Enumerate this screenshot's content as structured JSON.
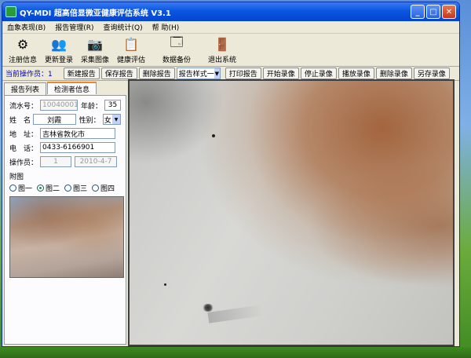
{
  "window": {
    "title": "QY-MDI 超高倍显微亚健康评估系统 V3.1",
    "min_glyph": "_",
    "max_glyph": "□",
    "close_glyph": "✕"
  },
  "menu": [
    "血象表现(B)",
    "报告管理(R)",
    "查询统计(Q)",
    "帮 助(H)"
  ],
  "toolbar": [
    {
      "label": "注册信息",
      "icon": "gear-icon",
      "glyph": "⚙"
    },
    {
      "label": "更新登录",
      "icon": "users-icon",
      "glyph": "👥"
    },
    {
      "label": "采集图像",
      "icon": "camera-icon",
      "glyph": "📷"
    },
    {
      "label": "健康评估",
      "icon": "clipboard-icon",
      "glyph": "📋"
    },
    {
      "label": "数据备份",
      "icon": "backup-icon",
      "glyph": "🗔"
    },
    {
      "label": "退出系统",
      "icon": "exit-icon",
      "glyph": "🚪"
    }
  ],
  "opbar": {
    "operator_label": "当前操作员：1",
    "new_report": "新建报告",
    "save_report": "保存报告",
    "delete_report": "删除报告",
    "report_style": "报告样式一",
    "print_report": "打印报告",
    "start_record": "开始录像",
    "stop_record": "停止录像",
    "play_record": "播放录像",
    "delete_record": "删除录像",
    "save_as_record": "另存录像"
  },
  "tabs": [
    "报告列表",
    "检测者信息"
  ],
  "form": {
    "serial_label": "流水号：",
    "serial_value": "10040001",
    "age_label": "年龄：",
    "age_value": "35",
    "name_label": "姓　名",
    "name_value": "刘霞",
    "gender_label": "性别：",
    "gender_value": "女",
    "address_label": "地　址：",
    "address_value": "吉林省敦化市",
    "phone_label": "电　话：",
    "phone_value": "0433-6166901",
    "operator_label": "操作员：",
    "operator_value": "1",
    "date_value": "2010-4-7"
  },
  "attach": {
    "title": "附图",
    "options": [
      "图一",
      "图二",
      "图三",
      "图四"
    ],
    "selected_index": 1
  }
}
